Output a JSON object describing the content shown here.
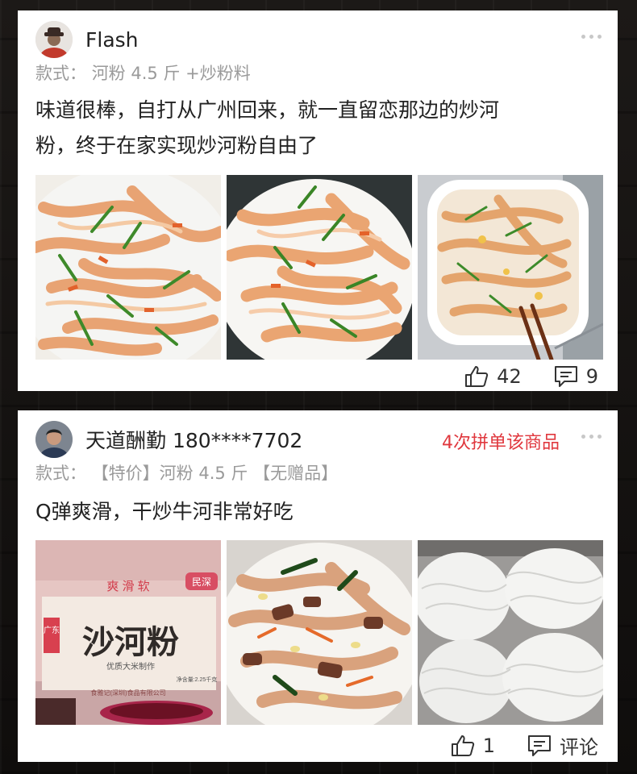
{
  "reviews": [
    {
      "user": {
        "name": "Flash"
      },
      "spec_label": "款式：",
      "spec_value": "河粉 4.5 斤 +炒粉料",
      "text_line1": "味道很棒，自打从广州回来，就一直留恋那边的炒河",
      "text_line2": "粉，终于在家实现炒河粉自由了",
      "photos": [
        "fried-noodles-photo",
        "fried-noodles-photo",
        "fried-noodles-bowl-photo"
      ],
      "likes": "42",
      "comments": "9"
    },
    {
      "user": {
        "name": "天道酬勤 180****7702"
      },
      "group_buy_tag": "4次拼单该商品",
      "spec_label": "款式：",
      "spec_value": "【特价】河粉 4.5 斤 【无赠品】",
      "text_line1": "Q弹爽滑，干炒牛河非常好吃",
      "photos": [
        "package-photo",
        "beef-fried-noodles-photo",
        "raw-noodles-photo"
      ],
      "package": {
        "brand": "民深",
        "tagline": "爽 滑 软",
        "region": "广东",
        "product": "沙河粉",
        "subtitle": "优质大米制作",
        "net": "净含量:2.25千克",
        "maker": "食雅记(深圳)食品有限公司"
      },
      "likes": "1",
      "comments": "评论"
    }
  ],
  "colors": {
    "accent": "#e0383e",
    "muted": "#9a9a9a",
    "background": "#151311"
  }
}
